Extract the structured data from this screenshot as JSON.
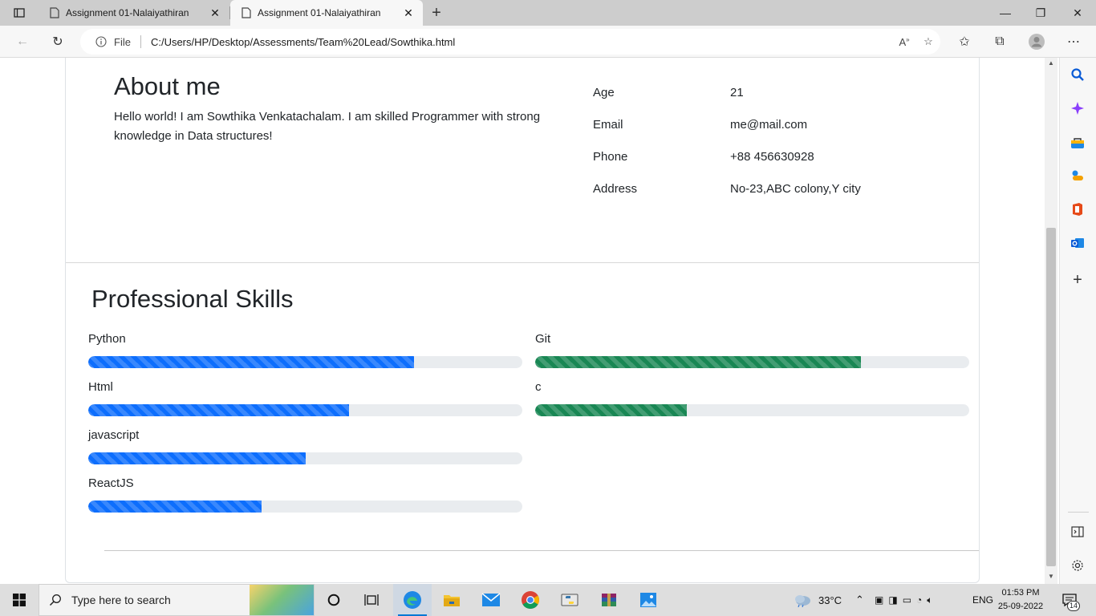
{
  "browser": {
    "tabs": [
      {
        "title": "Assignment 01-Nalaiyathiran",
        "active": false
      },
      {
        "title": "Assignment 01-Nalaiyathiran",
        "active": true
      }
    ],
    "address": {
      "scheme_label": "File",
      "url": "C:/Users/HP/Desktop/Assessments/Team%20Lead/Sowthika.html"
    },
    "window_controls": {
      "minimize": "—",
      "restore": "❐",
      "close": "✕"
    }
  },
  "about": {
    "heading": "About me",
    "bio": "Hello world! I am Sowthika Venkatachalam. I am skilled Programmer with strong knowledge in Data structures!",
    "details": [
      {
        "label": "Age",
        "value": "21"
      },
      {
        "label": "Email",
        "value": "me@mail.com"
      },
      {
        "label": "Phone",
        "value": "+88 456630928"
      },
      {
        "label": "Address",
        "value": "No-23,ABC colony,Y city"
      }
    ]
  },
  "skills": {
    "heading": "Professional Skills",
    "left": [
      {
        "name": "Python",
        "percent": 75,
        "color": "#0d6efd"
      },
      {
        "name": "Html",
        "percent": 60,
        "color": "#0d6efd"
      },
      {
        "name": "javascript",
        "percent": 50,
        "color": "#0d6efd"
      },
      {
        "name": "ReactJS",
        "percent": 40,
        "color": "#0d6efd"
      }
    ],
    "right": [
      {
        "name": "Git",
        "percent": 75,
        "color": "#198754"
      },
      {
        "name": "c",
        "percent": 35,
        "color": "#198754"
      }
    ]
  },
  "taskbar": {
    "search_placeholder": "Type here to search",
    "weather": "33°C",
    "language": "ENG",
    "time": "01:53 PM",
    "date": "25-09-2022",
    "notification_count": "14"
  }
}
